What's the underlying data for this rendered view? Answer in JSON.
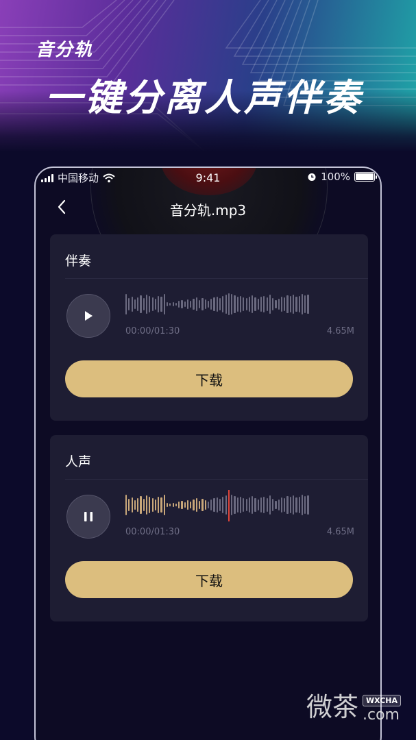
{
  "banner": {
    "subtitle": "音分轨",
    "title": "一键分离人声伴奏"
  },
  "status_bar": {
    "carrier": "中国移动",
    "time": "9:41",
    "battery": "100%"
  },
  "nav": {
    "title": "音分轨.mp3",
    "back_icon": "chevron-left-icon"
  },
  "tracks": [
    {
      "title": "伴奏",
      "state": "paused",
      "control_icon": "play-icon",
      "time": "00:00/01:30",
      "size": "4.65M",
      "progress": 0,
      "download_label": "下载"
    },
    {
      "title": "人声",
      "state": "playing",
      "control_icon": "pause-icon",
      "time": "00:00/01:30",
      "size": "4.65M",
      "progress": 0.45,
      "download_label": "下载"
    }
  ],
  "watermark": {
    "text": "微茶",
    "tag": "WXCHA",
    "domain": ".com"
  },
  "colors": {
    "accent": "#dcbe7e",
    "wave_played": "#c9a77a",
    "wave_unplayed": "#6b6a80",
    "playhead": "#e0443a",
    "card_bg": "#1e1d33",
    "page_bg": "#0c0a2a"
  }
}
